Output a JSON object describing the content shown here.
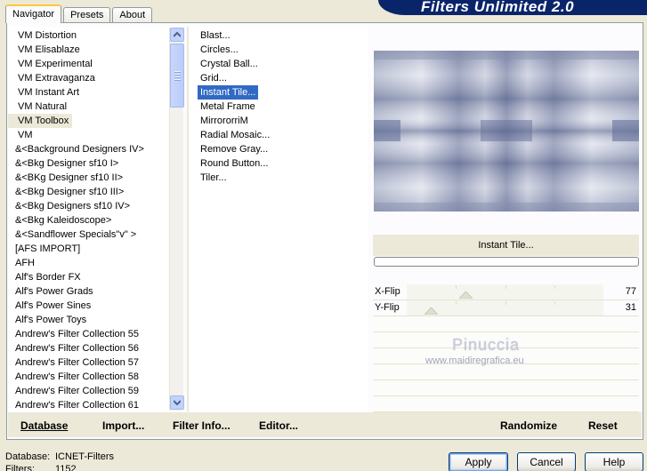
{
  "tabs": [
    "Navigator",
    "Presets",
    "About"
  ],
  "banner_title": "Filters Unlimited 2.0",
  "categories": [
    "VM Distortion",
    "VM Elisablaze",
    "VM Experimental",
    "VM Extravaganza",
    "VM Instant Art",
    "VM Natural",
    "VM Toolbox",
    "VM",
    "&<Background Designers IV>",
    "&<Bkg Designer sf10 I>",
    "&<BKg Designer sf10 II>",
    "&<Bkg Designer sf10 III>",
    "&<Bkg Designers sf10 IV>",
    "&<Bkg Kaleidoscope>",
    "&<Sandflower Specials\"v\" >",
    "[AFS IMPORT]",
    "AFH",
    "Alf's Border FX",
    "Alf's Power Grads",
    "Alf's Power Sines",
    "Alf's Power Toys",
    "Andrew's Filter Collection 55",
    "Andrew's Filter Collection 56",
    "Andrew's Filter Collection 57",
    "Andrew's Filter Collection 58",
    "Andrew's Filter Collection 59",
    "Andrew's Filter Collection 61"
  ],
  "selected_category": "VM Toolbox",
  "filters": [
    "Blast...",
    "Circles...",
    "Crystal Ball...",
    "Grid...",
    "Instant Tile...",
    "Metal Frame",
    "MirrororriM",
    "Radial Mosaic...",
    "Remove Gray...",
    "Round Button...",
    "Tiler..."
  ],
  "selected_filter": "Instant Tile...",
  "preview_filter_name": "Instant Tile...",
  "parameters": [
    {
      "name": "X-Flip",
      "value": "77",
      "level": 0.3
    },
    {
      "name": "Y-Flip",
      "value": "31",
      "level": 0.12
    }
  ],
  "watermark": {
    "line1": "Pinuccia",
    "line2": "www.maidiregrafica.eu"
  },
  "bottom_buttons": {
    "database": "Database",
    "import": "Import...",
    "filter_info": "Filter Info...",
    "editor": "Editor...",
    "randomize": "Randomize",
    "reset": "Reset"
  },
  "status": {
    "database_label": "Database:",
    "database_value": "ICNET-Filters",
    "filters_label": "Filters:",
    "filters_value": "1152"
  },
  "dialog_buttons": {
    "apply": "Apply",
    "cancel": "Cancel",
    "help": "Help"
  },
  "colors": {
    "accent": "#316ac5",
    "banner": "#0a246a",
    "face": "#ece9d8"
  }
}
